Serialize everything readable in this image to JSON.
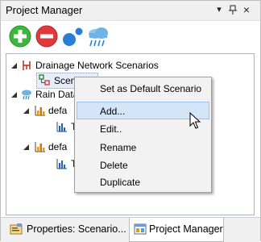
{
  "window": {
    "title": "Project Manager",
    "menu_glyph": "▾",
    "pin_glyph": "ᵖ",
    "close_glyph": "×"
  },
  "toolbar": {
    "buttons": [
      {
        "name": "add",
        "icon": "plus-icon",
        "color": "#3cb63c"
      },
      {
        "name": "remove",
        "icon": "minus-icon",
        "color": "#e0393a"
      },
      {
        "name": "node",
        "icon": "dots-icon",
        "color": "#2a7fd4"
      },
      {
        "name": "rain",
        "icon": "rain-cloud-icon",
        "color": "#4aa3df"
      }
    ]
  },
  "tree": {
    "items": [
      {
        "label": "Drainage Network Scenarios",
        "icon": "network-icon",
        "expanded": true
      },
      {
        "label": "Scenario1",
        "icon": "scenario-icon",
        "selected": true
      },
      {
        "label": "Rain Data",
        "icon": "rain-cloud-icon",
        "expanded": true
      },
      {
        "label": "defa",
        "icon": "bar-chart-icon",
        "expanded": true
      },
      {
        "label": "T",
        "icon": "hydrograph-icon"
      },
      {
        "label": "defa",
        "icon": "bar-chart-icon",
        "expanded": true
      },
      {
        "label": "T",
        "icon": "hydrograph-icon"
      }
    ]
  },
  "context_menu": {
    "items": [
      {
        "label": "Set as Default Scenario"
      },
      {
        "label": "Add...",
        "hovered": true
      },
      {
        "label": "Edit.."
      },
      {
        "label": "Rename"
      },
      {
        "label": "Delete"
      },
      {
        "label": "Duplicate"
      }
    ]
  },
  "tabs": [
    {
      "label": "Properties: Scenario...",
      "active": false
    },
    {
      "label": "Project Manager",
      "active": true
    }
  ]
}
